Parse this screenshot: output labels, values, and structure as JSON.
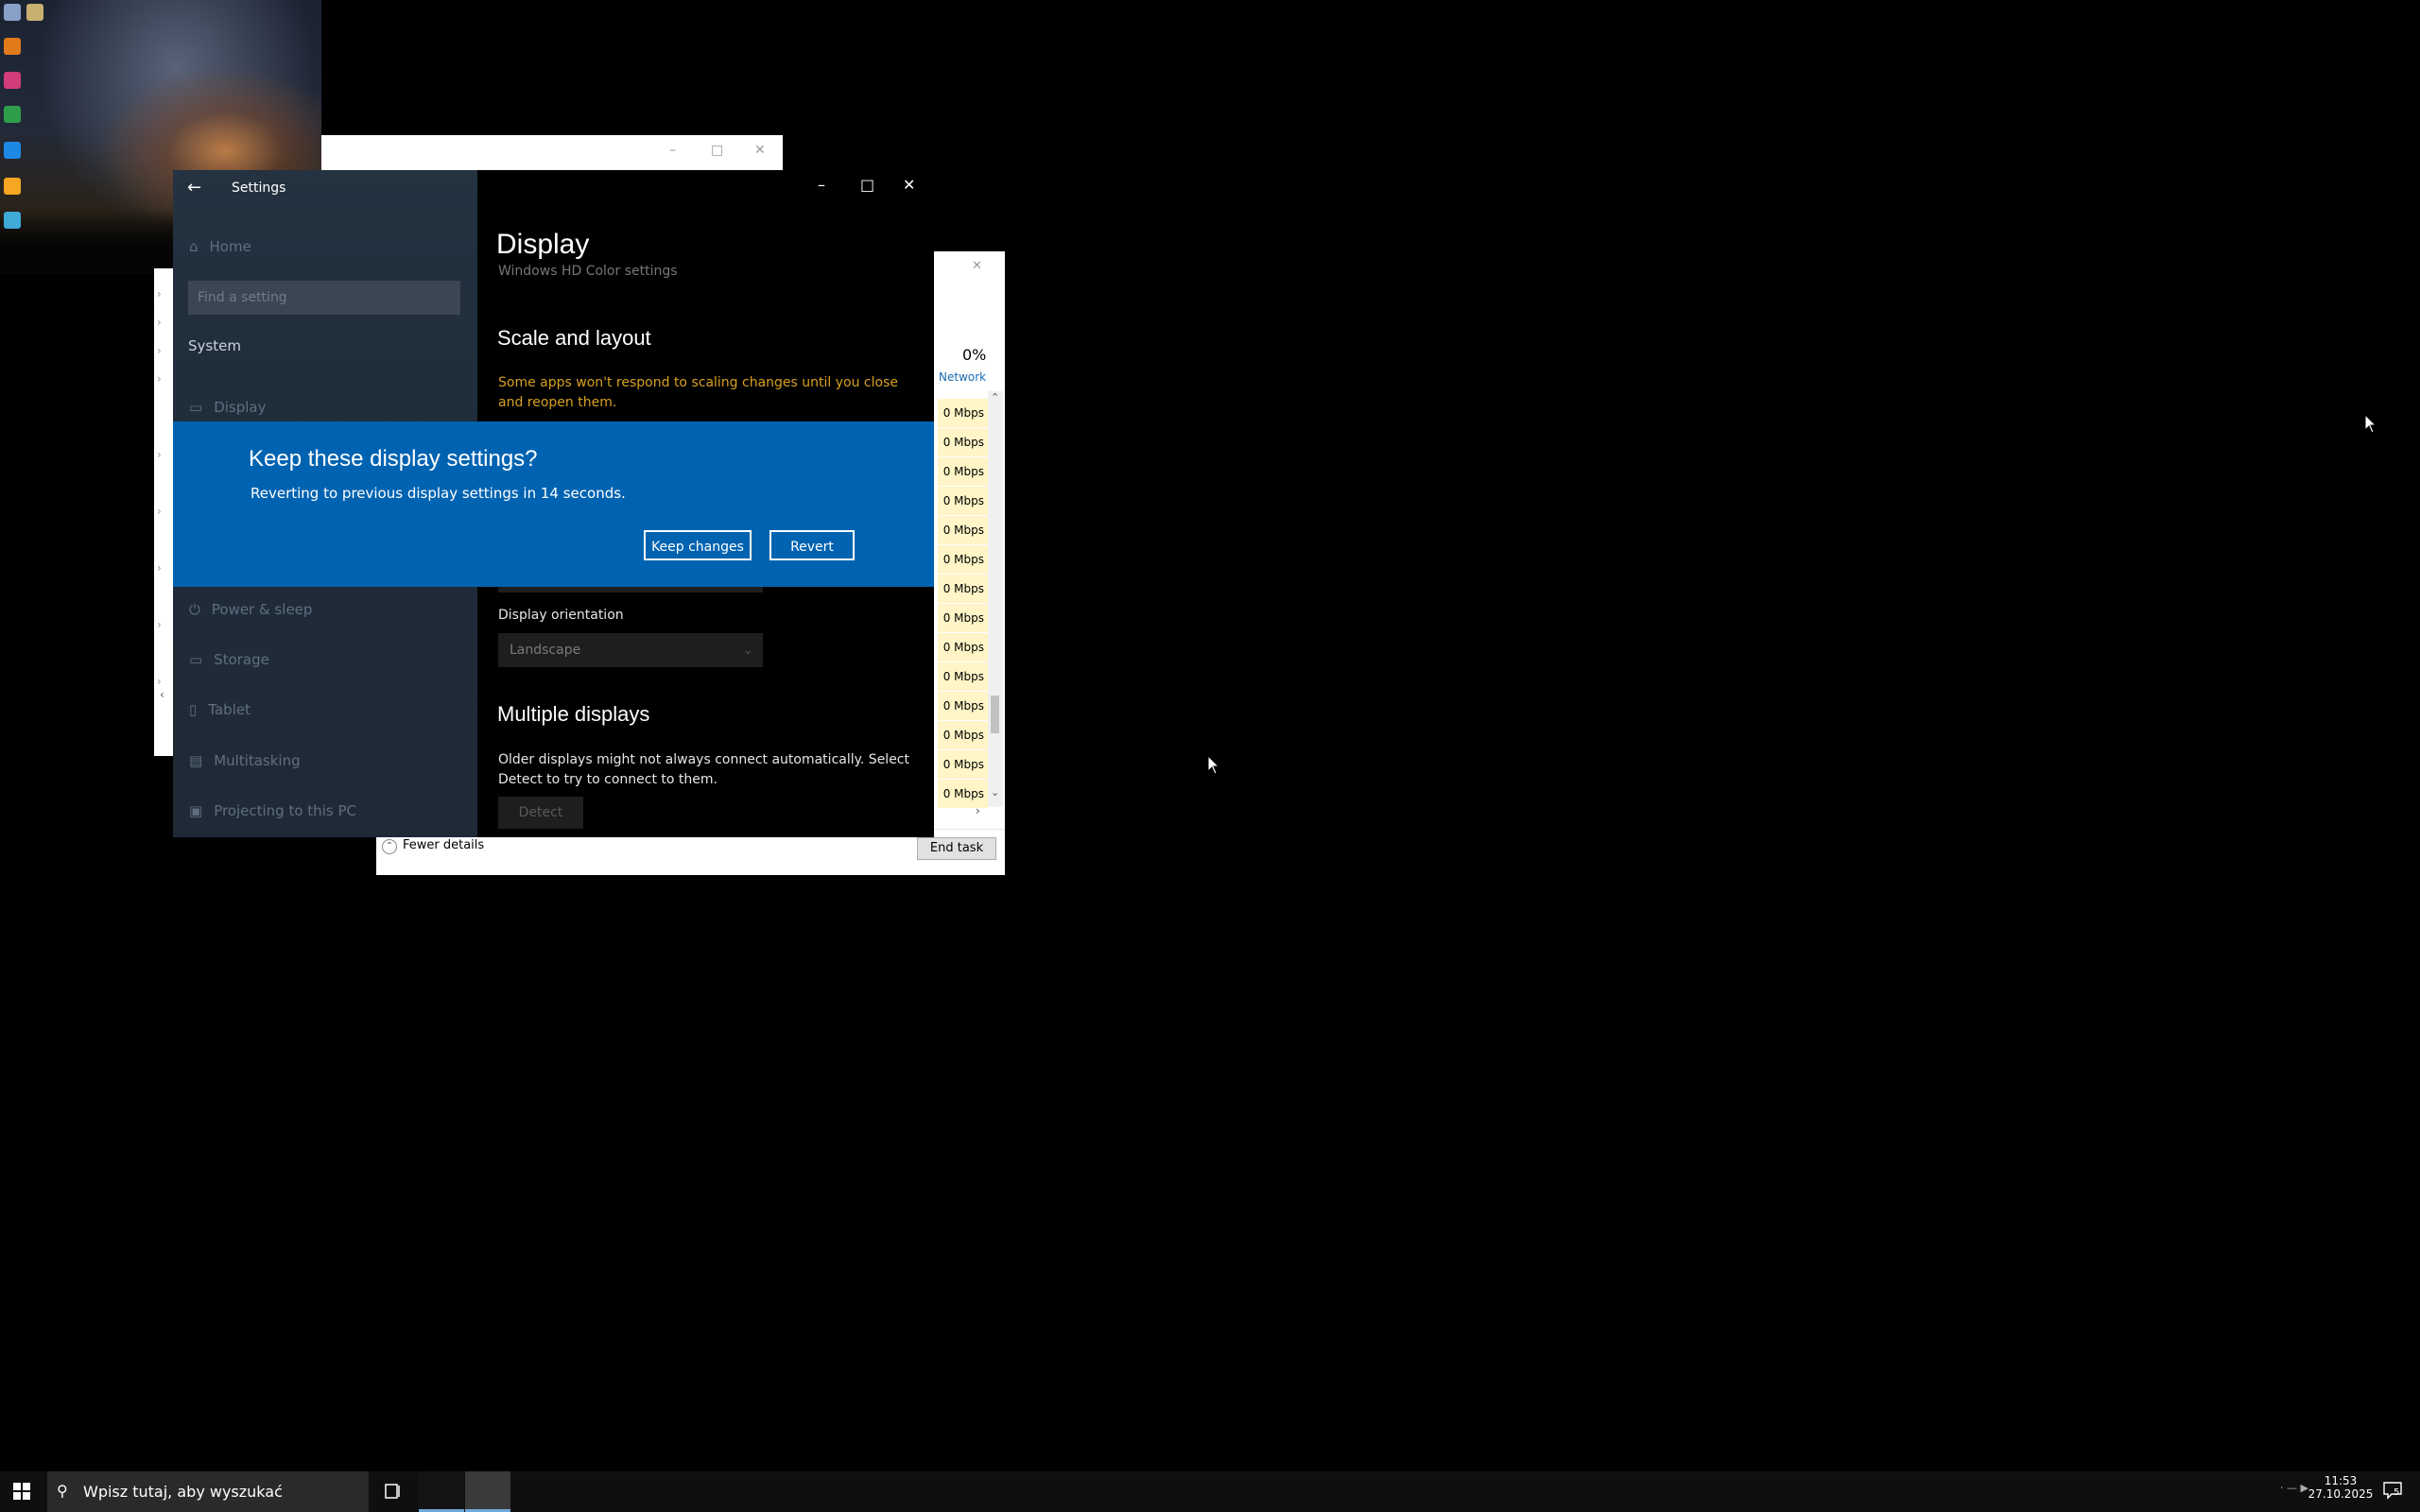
{
  "colors": {
    "dialog_bg": "#0063b1",
    "warning_text": "#d8a020",
    "mbps_cell_bg": "#fff5c6",
    "taskbar_bg": "#0f0f0f"
  },
  "settings": {
    "title": "Settings",
    "nav": {
      "home": "Home",
      "search_placeholder": "Find a setting",
      "section": "System",
      "items": [
        "Display",
        "Power & sleep",
        "Storage",
        "Tablet",
        "Multitasking",
        "Projecting to this PC"
      ]
    },
    "page_title": "Display",
    "hdr_color_link": "Windows HD Color settings",
    "scale_heading": "Scale and layout",
    "scale_warning": "Some apps won't respond to scaling changes until you close and reopen them.",
    "orientation_label": "Display orientation",
    "orientation_value": "Landscape",
    "multiple_heading": "Multiple displays",
    "multiple_text": "Older displays might not always connect automatically. Select Detect to try to connect to them.",
    "detect_button": "Detect"
  },
  "dialog": {
    "title": "Keep these display settings?",
    "message": "Reverting to previous display settings in 14 seconds.",
    "keep_button": "Keep changes",
    "revert_button": "Revert"
  },
  "task_manager": {
    "network_percent": "0%",
    "network_label": "Network",
    "rows": [
      "0 Mbps",
      "0 Mbps",
      "0 Mbps",
      "0 Mbps",
      "0 Mbps",
      "0 Mbps",
      "0 Mbps",
      "0 Mbps",
      "0 Mbps",
      "0 Mbps",
      "0 Mbps",
      "0 Mbps",
      "0 Mbps",
      "0 Mbps"
    ],
    "fewer_details": "Fewer details",
    "end_task": "End task"
  },
  "taskbar": {
    "search_placeholder": "Wpisz tutaj, aby wyszukać",
    "time": "11:53",
    "date": "27.10.2025",
    "notification_count": "5"
  },
  "icons": [
    "windows-start-icon",
    "search-icon",
    "task-view-icon",
    "notification-icon",
    "back-arrow-icon",
    "home-icon",
    "display-icon",
    "power-icon",
    "storage-icon",
    "tablet-icon",
    "multitasking-icon",
    "projecting-icon",
    "mouse-cursor-icon"
  ]
}
